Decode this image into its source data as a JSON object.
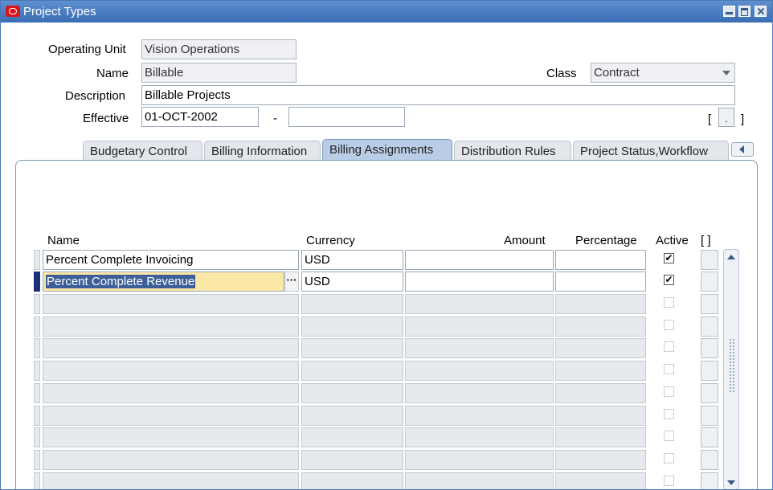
{
  "window": {
    "title": "Project Types"
  },
  "header": {
    "operating_unit_label": "Operating Unit",
    "operating_unit_value": "Vision Operations",
    "name_label": "Name",
    "name_value": "Billable",
    "class_label": "Class",
    "class_value": "Contract",
    "description_label": "Description",
    "description_value": "Billable Projects",
    "effective_label": "Effective",
    "effective_from": "01-OCT-2002",
    "effective_sep": "-",
    "effective_to": "",
    "dff_open": "[",
    "dff_close": "]",
    "dff_dot": "."
  },
  "tabs": [
    {
      "label": "Budgetary Control",
      "active": false
    },
    {
      "label": "Billing Information",
      "active": false
    },
    {
      "label": "Billing Assignments",
      "active": true
    },
    {
      "label": "Distribution Rules",
      "active": false
    },
    {
      "label": "Project Status,Workflow",
      "active": false
    }
  ],
  "grid": {
    "headers": {
      "name": "Name",
      "currency": "Currency",
      "amount": "Amount",
      "percentage": "Percentage",
      "active": "Active",
      "flex": "[ ]"
    },
    "rows": [
      {
        "name": "Percent Complete Invoicing",
        "currency": "USD",
        "amount": "",
        "percentage": "",
        "active": true
      },
      {
        "name": "Percent Complete Revenue",
        "currency": "USD",
        "amount": "",
        "percentage": "",
        "active": true
      }
    ],
    "lov_glyph": "···",
    "check_glyph": "✔"
  }
}
